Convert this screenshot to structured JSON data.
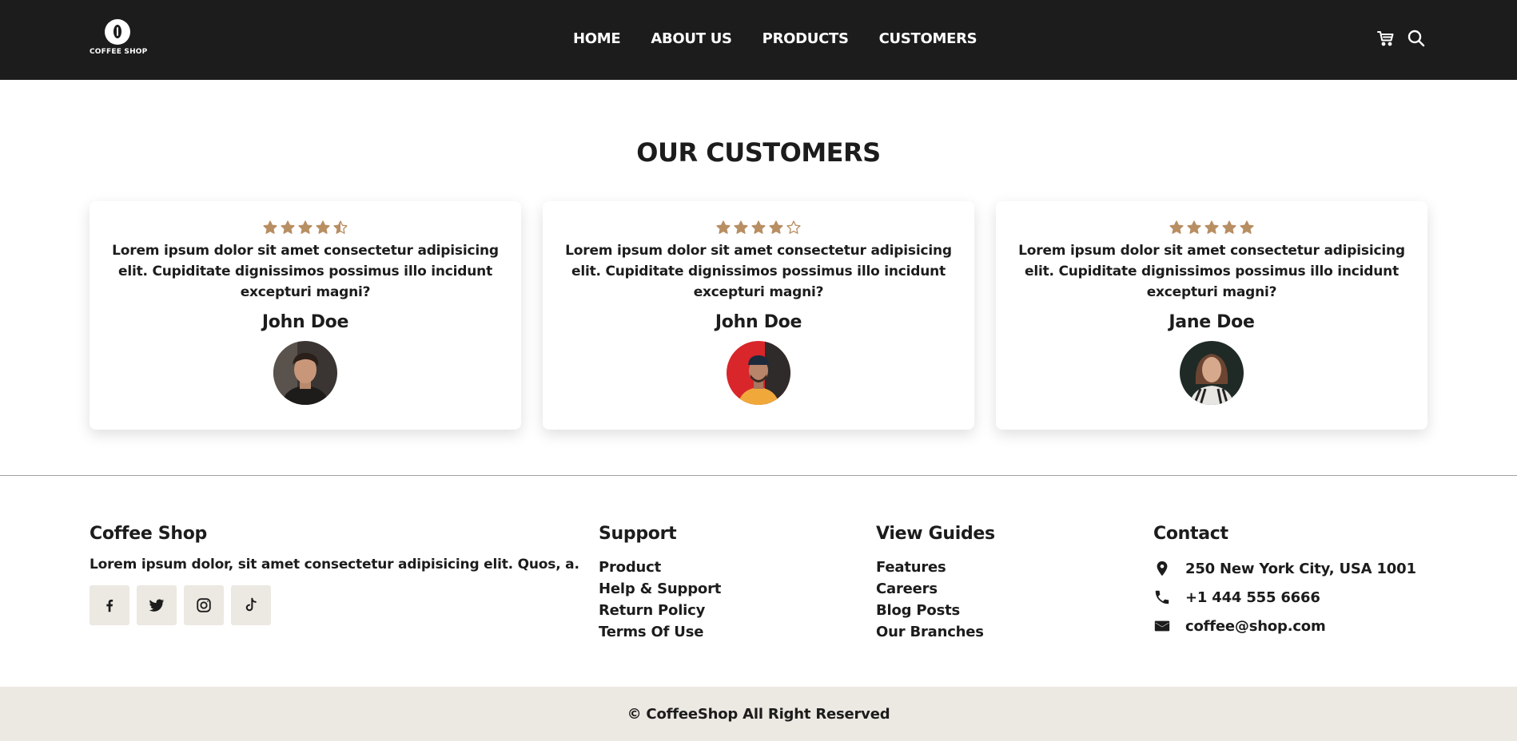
{
  "header": {
    "logo_text": "COFFEE SHOP",
    "nav": [
      "HOME",
      "ABOUT US",
      "PRODUCTS",
      "CUSTOMERS"
    ],
    "icons": [
      "cart-icon",
      "search-icon"
    ]
  },
  "customers": {
    "title": "OUR CUSTOMERS",
    "cards": [
      {
        "rating": 4.5,
        "quote": "Lorem ipsum dolor sit amet consectetur adipisicing elit. Cupiditate dignissimos possimus illo incidunt excepturi magni?",
        "name": "John Doe"
      },
      {
        "rating": 4,
        "quote": "Lorem ipsum dolor sit amet consectetur adipisicing elit. Cupiditate dignissimos possimus illo incidunt excepturi magni?",
        "name": "John Doe"
      },
      {
        "rating": 5,
        "quote": "Lorem ipsum dolor sit amet consectetur adipisicing elit. Cupiditate dignissimos possimus illo incidunt excepturi magni?",
        "name": "Jane Doe"
      }
    ]
  },
  "footer": {
    "brand": {
      "title": "Coffee Shop",
      "description": "Lorem ipsum dolor, sit amet consectetur adipisicing elit. Quos, a.",
      "socials": [
        "facebook-icon",
        "twitter-icon",
        "instagram-icon",
        "tiktok-icon"
      ]
    },
    "support": {
      "title": "Support",
      "links": [
        "Product",
        "Help & Support",
        "Return Policy",
        "Terms Of Use"
      ]
    },
    "guides": {
      "title": "View Guides",
      "links": [
        "Features",
        "Careers",
        "Blog Posts",
        "Our Branches"
      ]
    },
    "contact": {
      "title": "Contact",
      "items": [
        {
          "icon": "location-pin-icon",
          "text": "250 New York City, USA 1001"
        },
        {
          "icon": "phone-icon",
          "text": "+1 444 555 6666"
        },
        {
          "icon": "mail-icon",
          "text": "coffee@shop.com"
        }
      ]
    },
    "copyright": "© CoffeeShop All Right Reserved"
  },
  "colors": {
    "header_bg": "#1c1c1c",
    "star": "#b88e63",
    "footer_bottom_bg": "#ece8e2",
    "social_bg": "#ece8e2",
    "text": "#1c1c1c"
  }
}
